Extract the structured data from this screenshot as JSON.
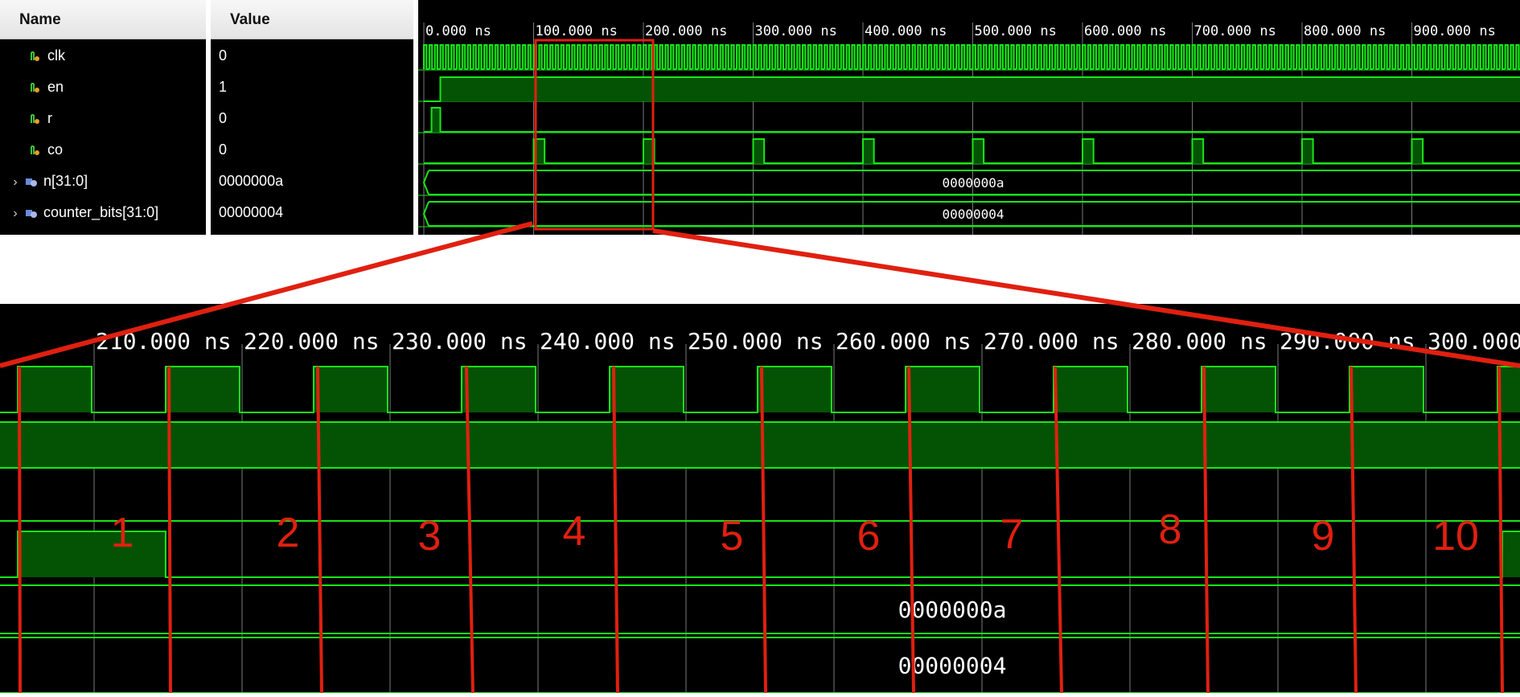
{
  "headers": {
    "name": "Name",
    "value": "Value"
  },
  "signals": [
    {
      "name": "clk",
      "value": "0",
      "icon": "scalar-signal-icon",
      "expandable": false
    },
    {
      "name": "en",
      "value": "1",
      "icon": "scalar-signal-icon",
      "expandable": false
    },
    {
      "name": "r",
      "value": "0",
      "icon": "scalar-signal-icon",
      "expandable": false
    },
    {
      "name": "co",
      "value": "0",
      "icon": "scalar-signal-icon",
      "expandable": false
    },
    {
      "name": "n[31:0]",
      "value": "0000000a",
      "icon": "bus-signal-icon",
      "expandable": true
    },
    {
      "name": "counter_bits[31:0]",
      "value": "00000004",
      "icon": "bus-signal-icon",
      "expandable": true
    }
  ],
  "top_timeline": {
    "ticks": [
      "0.000 ns",
      "100.000 ns",
      "200.000 ns",
      "300.000 ns",
      "400.000 ns",
      "500.000 ns",
      "600.000 ns",
      "700.000 ns",
      "800.000 ns",
      "900.000 ns"
    ],
    "bus_values": [
      "0000000a",
      "00000004"
    ]
  },
  "zoom_timeline": {
    "ticks": [
      "210.000 ns",
      "220.000 ns",
      "230.000 ns",
      "240.000 ns",
      "250.000 ns",
      "260.000 ns",
      "270.000 ns",
      "280.000 ns",
      "290.000 ns",
      "300.000"
    ],
    "bus_values": [
      "0000000a",
      "00000004"
    ],
    "cycle_labels": [
      "1",
      "2",
      "3",
      "4",
      "5",
      "6",
      "7",
      "8",
      "9",
      "10"
    ]
  },
  "colors": {
    "waveform": "#19e619",
    "fill": "#045304",
    "grid": "#7a7a7a",
    "annotation": "#e02010",
    "background": "#000000"
  }
}
